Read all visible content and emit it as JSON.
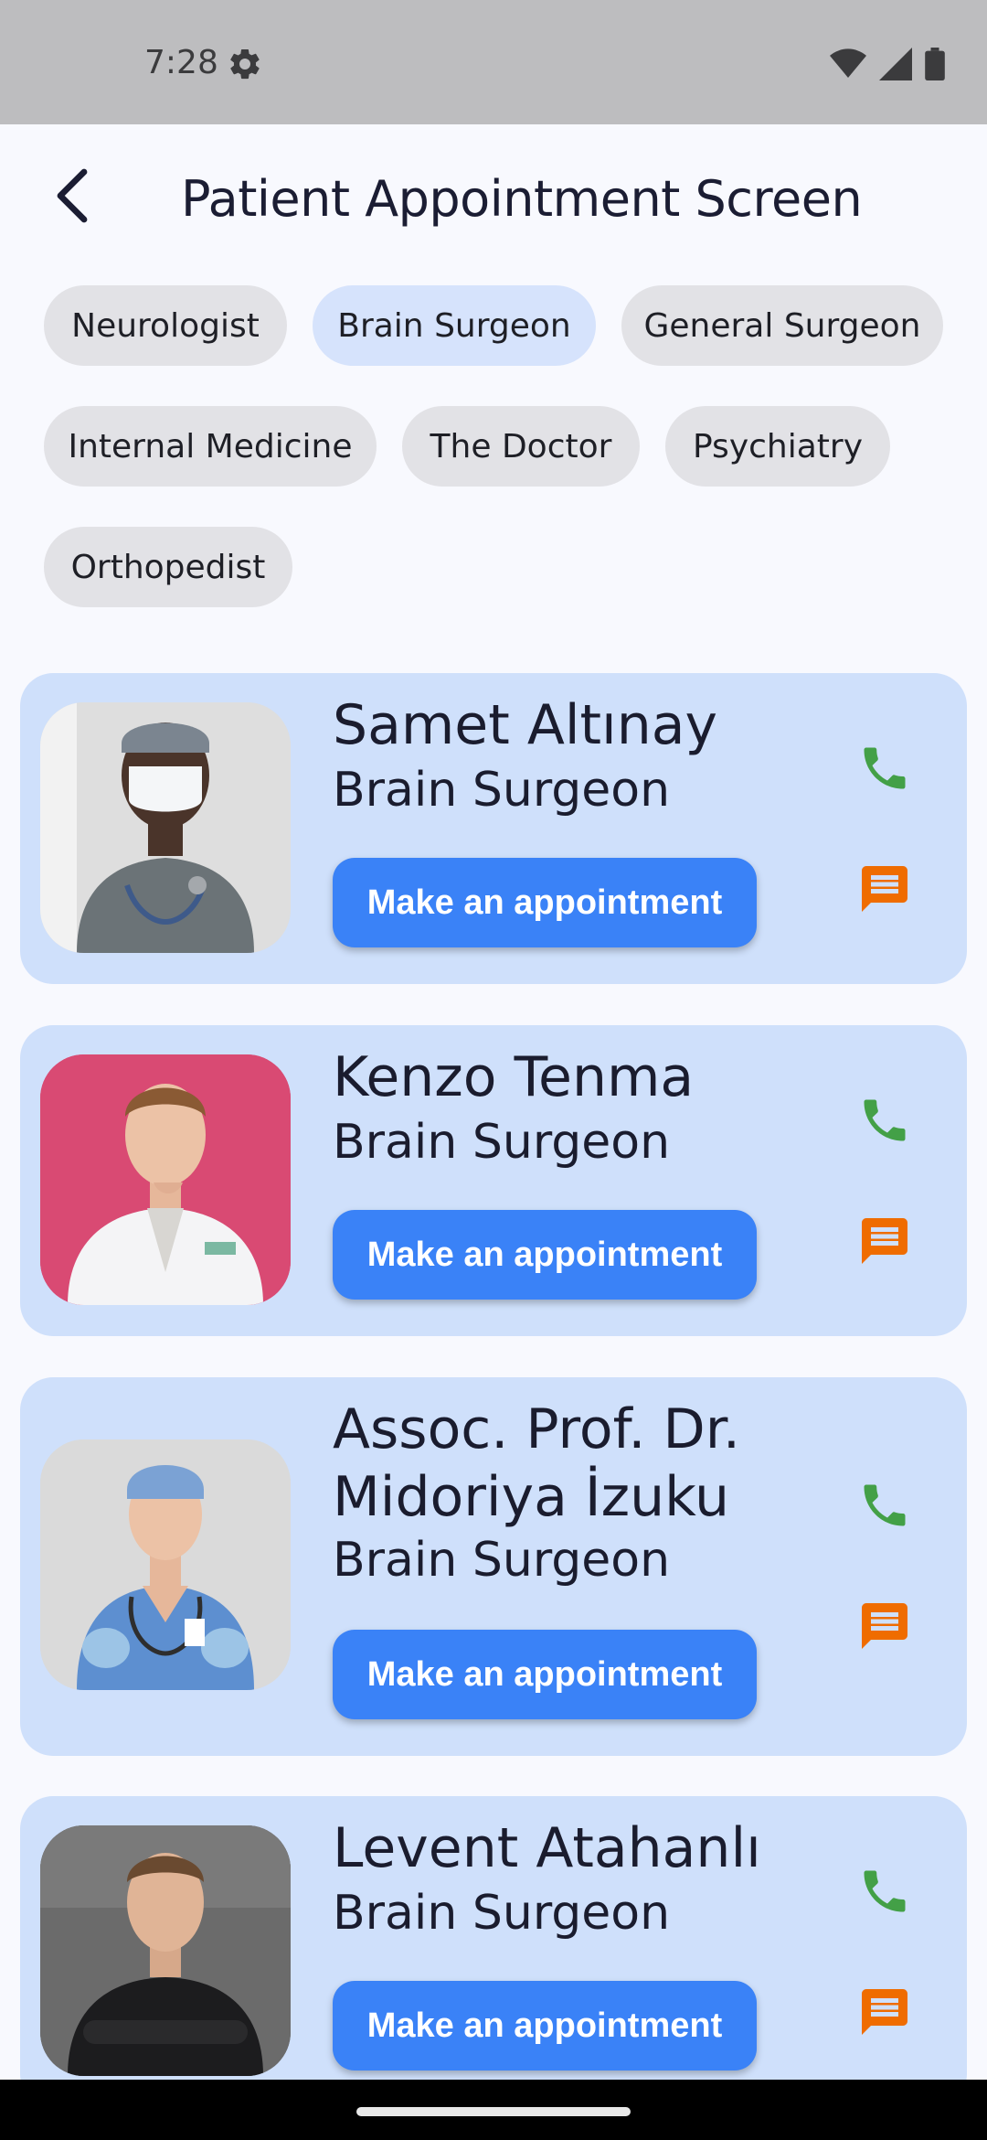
{
  "status_bar": {
    "time": "7:28"
  },
  "app_bar": {
    "title": "Patient Appointment Screen"
  },
  "categories": [
    {
      "label": "Neurologist",
      "selected": false
    },
    {
      "label": "Brain Surgeon",
      "selected": true
    },
    {
      "label": "General Surgeon",
      "selected": false
    },
    {
      "label": "Internal Medicine",
      "selected": false
    },
    {
      "label": "The Doctor",
      "selected": false
    },
    {
      "label": "Psychiatry",
      "selected": false
    },
    {
      "label": "Orthopedist",
      "selected": false
    }
  ],
  "doctors": [
    {
      "name": "Samet Altınay",
      "specialty": "Brain Surgeon",
      "button_label": "Make an appointment",
      "photo_bg": "#dcdcdc"
    },
    {
      "name": "Kenzo Tenma",
      "specialty": "Brain Surgeon",
      "button_label": "Make an appointment",
      "photo_bg": "#d94a73"
    },
    {
      "name": "Assoc. Prof. Dr. Midoriya İzuku",
      "specialty": "Brain Surgeon",
      "button_label": "Make an appointment",
      "photo_bg": "#d9d9d9"
    },
    {
      "name": "Levent Atahanlı",
      "specialty": "Brain Surgeon",
      "button_label": "Make an appointment",
      "photo_bg": "#5a5a5a"
    }
  ],
  "colors": {
    "accent": "#3a82f7",
    "card": "#cfe0fb",
    "chip": "#e2e2e6",
    "chip_selected": "#d6e3fc",
    "phone_icon": "#43a047",
    "message_icon": "#ef6c00"
  },
  "icons": {
    "back": "arrow-back-icon",
    "call": "phone-icon",
    "message": "message-icon"
  }
}
